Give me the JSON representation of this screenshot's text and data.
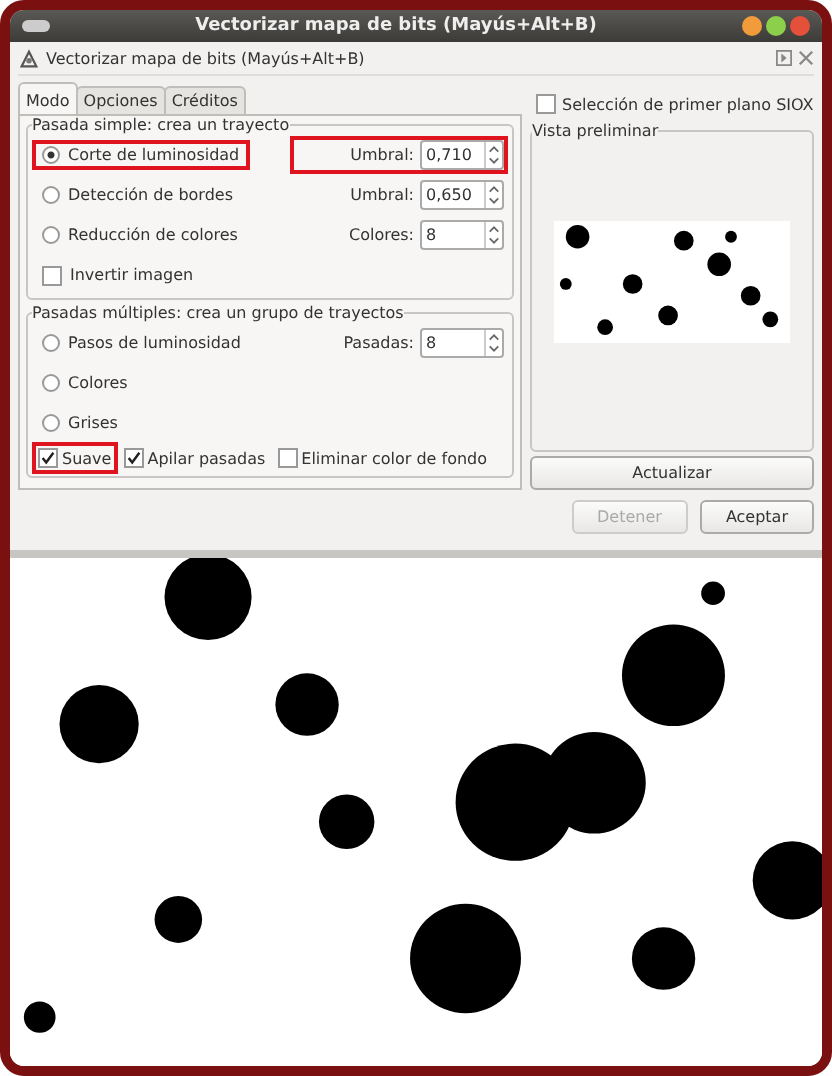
{
  "window": {
    "title": "Vectorizar mapa de bits (Mayús+Alt+B)"
  },
  "dialog_header": {
    "title": "Vectorizar mapa de bits (Mayús+Alt+B)"
  },
  "tabs": [
    {
      "label": "Modo",
      "selected": true
    },
    {
      "label": "Opciones",
      "selected": false
    },
    {
      "label": "Créditos",
      "selected": false
    }
  ],
  "single_scan": {
    "title": "Pasada simple: crea un trayecto",
    "options": [
      {
        "label": "Corte de luminosidad",
        "selected": true,
        "highlighted": true,
        "spin": {
          "label": "Umbral:",
          "value": "0,710",
          "highlighted": true
        }
      },
      {
        "label": "Detección de bordes",
        "selected": false,
        "highlighted": false,
        "spin": {
          "label": "Umbral:",
          "value": "0,650",
          "highlighted": false
        }
      },
      {
        "label": "Reducción de colores",
        "selected": false,
        "highlighted": false,
        "spin": {
          "label": "Colores:",
          "value": "8",
          "highlighted": false
        }
      }
    ],
    "invert": {
      "label": "Invertir imagen",
      "checked": false
    }
  },
  "multiple_scans": {
    "title": "Pasadas múltiples: crea un grupo de trayectos",
    "options": [
      {
        "label": "Pasos de luminosidad",
        "selected": false,
        "highlighted": false,
        "spin": {
          "label": "Pasadas:",
          "value": "8",
          "highlighted": false
        }
      },
      {
        "label": "Colores",
        "selected": false,
        "highlighted": false
      },
      {
        "label": "Grises",
        "selected": false,
        "highlighted": false
      }
    ],
    "checks": [
      {
        "label": "Suave",
        "checked": true,
        "highlighted": true
      },
      {
        "label": "Apilar pasadas",
        "checked": true,
        "highlighted": false
      },
      {
        "label": "Eliminar color de fondo",
        "checked": false,
        "highlighted": false
      }
    ]
  },
  "siox": {
    "label": "Selección de primer plano SIOX",
    "checked": false
  },
  "preview": {
    "title": "Vista preliminar",
    "button": "Actualizar"
  },
  "buttons": [
    {
      "label": "Detener",
      "disabled": true
    },
    {
      "label": "Aceptar",
      "disabled": false
    }
  ]
}
